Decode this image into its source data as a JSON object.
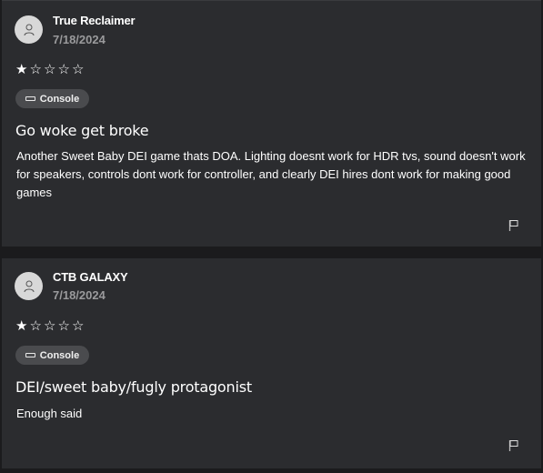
{
  "reviews": [
    {
      "author": "True Reclaimer",
      "date": "7/18/2024",
      "rating": 1,
      "rating_max": 5,
      "platform": "Console",
      "title": "Go woke get broke",
      "body": "Another Sweet Baby DEI game thats DOA. Lighting doesnt work for HDR tvs, sound doesn't work for speakers, controls dont work for controller, and clearly DEI hires dont work for making good games"
    },
    {
      "author": "CTB GALAXY",
      "date": "7/18/2024",
      "rating": 1,
      "rating_max": 5,
      "platform": "Console",
      "title": "DEI/sweet baby/fugly protagonist",
      "body": "Enough said"
    }
  ],
  "icons": {
    "avatar": "person-icon",
    "platform": "console-icon",
    "report": "flag-icon",
    "star_filled": "★",
    "star_empty": "☆"
  }
}
